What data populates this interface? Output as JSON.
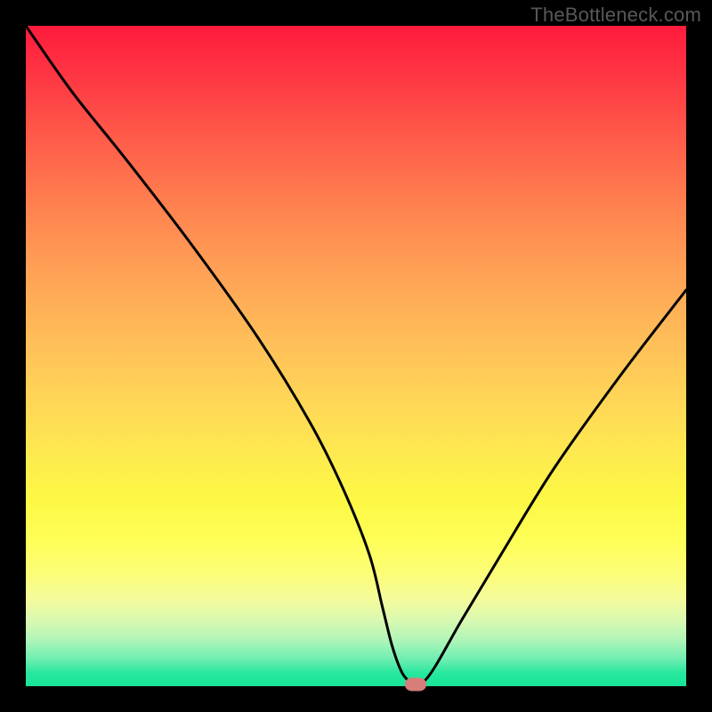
{
  "watermark": "TheBottleneck.com",
  "chart_data": {
    "type": "line",
    "title": "",
    "xlabel": "",
    "ylabel": "",
    "xlim": [
      0,
      100
    ],
    "ylim": [
      0,
      100
    ],
    "x": [
      0,
      7,
      15,
      25,
      35,
      43,
      48,
      52,
      54,
      55.5,
      57,
      58.5,
      60,
      62,
      66,
      72,
      80,
      90,
      100
    ],
    "values": [
      100,
      90,
      80,
      67,
      53,
      40,
      30,
      20,
      12,
      6,
      2,
      0.5,
      0.5,
      3,
      10,
      20,
      33,
      47,
      60
    ],
    "marker": {
      "x": 59,
      "y": 0.3
    },
    "background_gradient_colors": [
      "#fe1b3c",
      "#ffd957",
      "#fefe58",
      "#16e598"
    ]
  }
}
